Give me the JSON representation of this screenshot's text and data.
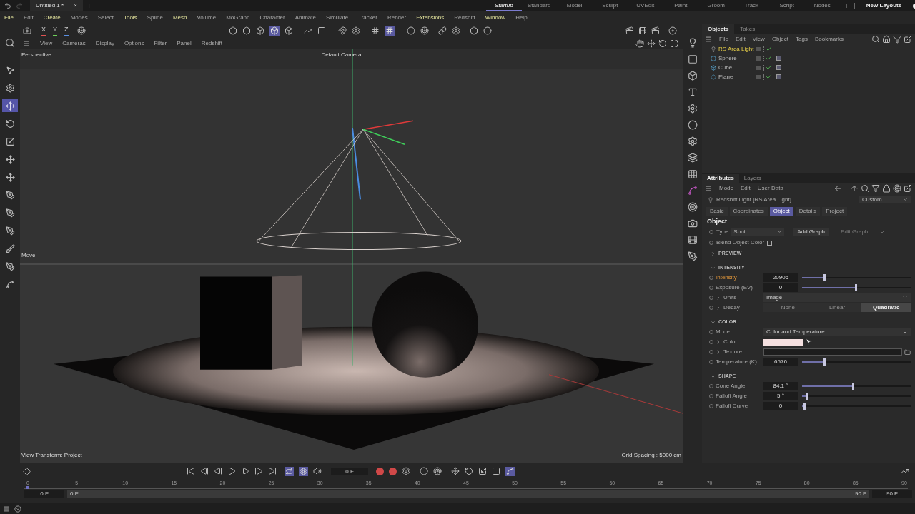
{
  "title_bar": {
    "document_tab": "Untitled 1 *",
    "close": "×",
    "add": "+",
    "layouts": [
      {
        "label": "Startup",
        "selected": true
      },
      {
        "label": "Standard",
        "selected": false
      },
      {
        "label": "Model",
        "selected": false
      },
      {
        "label": "Sculpt",
        "selected": false
      },
      {
        "label": "UVEdit",
        "selected": false
      },
      {
        "label": "Paint",
        "selected": false
      },
      {
        "label": "Groom",
        "selected": false
      },
      {
        "label": "Track",
        "selected": false
      },
      {
        "label": "Script",
        "selected": false
      },
      {
        "label": "Nodes",
        "selected": false
      }
    ],
    "layout_add": "+",
    "new_layouts": "New Layouts",
    "new_layouts_on": true
  },
  "menu": [
    {
      "label": "File",
      "highlighted": true
    },
    {
      "label": "Edit",
      "highlighted": false
    },
    {
      "label": "Create",
      "highlighted": true
    },
    {
      "label": "Modes",
      "highlighted": false
    },
    {
      "label": "Select",
      "highlighted": false
    },
    {
      "label": "Tools",
      "highlighted": true
    },
    {
      "label": "Spline",
      "highlighted": false
    },
    {
      "label": "Mesh",
      "highlighted": true
    },
    {
      "label": "Volume",
      "highlighted": false
    },
    {
      "label": "MoGraph",
      "highlighted": false
    },
    {
      "label": "Character",
      "highlighted": false
    },
    {
      "label": "Animate",
      "highlighted": false
    },
    {
      "label": "Simulate",
      "highlighted": false
    },
    {
      "label": "Tracker",
      "highlighted": false
    },
    {
      "label": "Render",
      "highlighted": false
    },
    {
      "label": "Extensions",
      "highlighted": true
    },
    {
      "label": "Redshift",
      "highlighted": false
    },
    {
      "label": "Window",
      "highlighted": true
    },
    {
      "label": "Help",
      "highlighted": false
    }
  ],
  "axes": [
    {
      "label": "X",
      "color": "#e05252"
    },
    {
      "label": "Y",
      "color": "#6fcf5a"
    },
    {
      "label": "Z",
      "color": "#5a8fe0"
    }
  ],
  "tools": [
    {
      "kind": "select",
      "selected": false
    },
    {
      "kind": "gear",
      "selected": false
    },
    {
      "kind": "move",
      "selected": true
    },
    {
      "kind": "rotate",
      "selected": false
    },
    {
      "kind": "scale",
      "selected": false
    },
    {
      "kind": "move",
      "selected": false
    },
    {
      "kind": "move",
      "selected": false
    },
    {
      "kind": "pen",
      "selected": false
    },
    {
      "kind": "pen",
      "selected": false
    },
    {
      "kind": "pen",
      "selected": false
    },
    {
      "kind": "brush",
      "selected": false
    },
    {
      "kind": "pen",
      "selected": false
    },
    {
      "kind": "spline",
      "selected": false
    }
  ],
  "viewport": {
    "menu": [
      "View",
      "Cameras",
      "Display",
      "Options",
      "Filter",
      "Panel",
      "Redshift"
    ],
    "view_name": "Perspective",
    "camera": "Default Camera",
    "tool_label": "Move",
    "view_transform": "View Transform: Project",
    "grid_spacing": "Grid Spacing : 5000 cm"
  },
  "objects_panel": {
    "tabs": [
      {
        "label": "Objects",
        "selected": true
      },
      {
        "label": "Takes",
        "selected": false
      }
    ],
    "menu": [
      "File",
      "Edit",
      "View",
      "Object",
      "Tags",
      "Bookmarks"
    ],
    "items": [
      {
        "name": "RS Area Light",
        "kind": "light",
        "selected": true
      },
      {
        "name": "Sphere",
        "kind": "sphere",
        "selected": false
      },
      {
        "name": "Cube",
        "kind": "cube",
        "selected": false
      },
      {
        "name": "Plane",
        "kind": "plane",
        "selected": false
      }
    ]
  },
  "attributes": {
    "tabs": [
      {
        "label": "Attributes",
        "selected": true
      },
      {
        "label": "Layers",
        "selected": false
      }
    ],
    "menu": [
      "Mode",
      "Edit",
      "User Data"
    ],
    "object_title": "Redshift Light [RS Area Light]",
    "preset": "Custom",
    "subtabs": [
      {
        "label": "Basic",
        "selected": false
      },
      {
        "label": "Coordinates",
        "selected": false
      },
      {
        "label": "Object",
        "selected": true
      },
      {
        "label": "Details",
        "selected": false
      },
      {
        "label": "Project",
        "selected": false
      }
    ],
    "heading": "Object",
    "type_label": "Type",
    "type_value": "Spot",
    "add_graph": "Add Graph",
    "edit_graph": "Edit Graph",
    "blend_label": "Blend Object Color",
    "blend_checked": false,
    "sections": [
      {
        "title": "PREVIEW",
        "expanded": false
      },
      {
        "title": "INTENSITY",
        "expanded": true,
        "rows": [
          {
            "kind": "slider",
            "label": "Intensity",
            "value": "20905",
            "level": 0.2,
            "highlighted": true,
            "expandable": false
          },
          {
            "kind": "slider",
            "label": "Exposure (EV)",
            "value": "0",
            "level": 0.49,
            "highlighted": false,
            "expandable": false
          },
          {
            "kind": "dropdown",
            "label": "Units",
            "value": "Image",
            "highlighted": false,
            "expandable": true
          },
          {
            "kind": "segmented",
            "label": "Decay",
            "options": [
              {
                "label": "None",
                "selected": false
              },
              {
                "label": "Linear",
                "selected": false
              },
              {
                "label": "Quadratic",
                "selected": true
              }
            ],
            "highlighted": false,
            "expandable": true
          }
        ]
      },
      {
        "title": "COLOR",
        "expanded": true,
        "rows": [
          {
            "kind": "dropdown",
            "label": "Mode",
            "value": "Color and Temperature",
            "highlighted": false,
            "expandable": false
          },
          {
            "kind": "color",
            "label": "Color",
            "color": "#f5e0e0",
            "highlighted": false,
            "expandable": true
          },
          {
            "kind": "texture",
            "label": "Texture",
            "highlighted": false,
            "expandable": true
          },
          {
            "kind": "slider",
            "label": "Temperature (K)",
            "value": "6576",
            "level": 0.2,
            "highlighted": false,
            "expandable": false
          }
        ]
      },
      {
        "title": "SHAPE",
        "expanded": true,
        "rows": [
          {
            "kind": "slider",
            "label": "Cone Angle",
            "value": "84.1 °",
            "level": 0.46,
            "highlighted": false,
            "expandable": false
          },
          {
            "kind": "slider",
            "label": "Falloff Angle",
            "value": "5 °",
            "level": 0.03,
            "highlighted": false,
            "expandable": false
          },
          {
            "kind": "slider",
            "label": "Falloff Curve",
            "value": "0",
            "level": 0.01,
            "highlighted": false,
            "expandable": false
          }
        ]
      }
    ]
  },
  "timeline": {
    "current_frame": "0 F",
    "ticks": [
      "0",
      "5",
      "10",
      "15",
      "20",
      "25",
      "30",
      "35",
      "40",
      "45",
      "50",
      "55",
      "60",
      "65",
      "70",
      "75",
      "80",
      "85",
      "90"
    ],
    "start": "0 F",
    "range_start": "0 F",
    "range_end": "90 F",
    "end": "90 F"
  }
}
